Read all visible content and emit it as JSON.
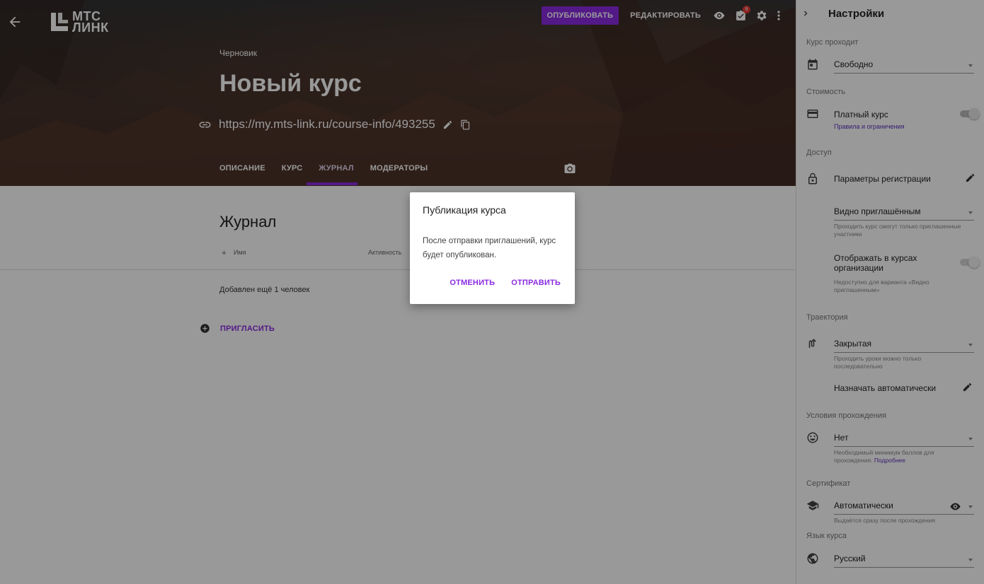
{
  "header": {
    "logo_line1": "МТС",
    "logo_line2": "ЛИНК",
    "publish_label": "ОПУБЛИКОВАТЬ",
    "edit_label": "РЕДАКТИРОВАТЬ",
    "tasks_badge": "9"
  },
  "course": {
    "status": "Черновик",
    "title": "Новый курс",
    "url": "https://my.mts-link.ru/course-info/493255"
  },
  "tabs": [
    {
      "label": "ОПИСАНИЕ"
    },
    {
      "label": "КУРС"
    },
    {
      "label": "ЖУРНАЛ"
    },
    {
      "label": "МОДЕРАТОРЫ"
    }
  ],
  "journal": {
    "title": "Журнал",
    "col_name": "Имя",
    "col_activity": "Активность",
    "added_text": "Добавлен ещё 1 человек",
    "invite_label": "ПРИГЛАСИТЬ"
  },
  "dialog": {
    "title": "Публикация курса",
    "body": "После отправки приглашений, курс будет опубликован.",
    "cancel_label": "ОТМЕНИТЬ",
    "send_label": "ОТПРАВИТЬ"
  },
  "settings": {
    "title": "Настройки",
    "pass_label": "Курс проходит",
    "pass_value": "Свободно",
    "cost_label": "Стоимость",
    "paid_label": "Платный курс",
    "rules_link": "Правила и ограничения",
    "access_label": "Доступ",
    "reg_params": "Параметры регистрации",
    "visibility_value": "Видно приглашённым",
    "visibility_hint": "Проходить курс смогут только приглашенные участники",
    "org_show_label": "Отображать в курсах организации",
    "org_show_hint": "Недоступно для варианта «Видно приглашенным»",
    "trajectory_label": "Траектория",
    "trajectory_value": "Закрытая",
    "trajectory_hint": "Проходить уроки можно только последовательно",
    "assign_auto": "Назначать автоматически",
    "conditions_label": "Условия прохождения",
    "conditions_value": "Нет",
    "conditions_hint": "Необходимый минимум баллов для прохождения.",
    "conditions_link": "Подробнее",
    "certificate_label": "Сертификат",
    "certificate_value": "Автоматически",
    "certificate_hint": "Выдаётся сразу после прохождения",
    "language_label": "Язык курса",
    "language_value": "Русский"
  },
  "colors": {
    "accent": "#8a2be2",
    "badge": "#e53935",
    "link": "#5b2fbd"
  }
}
